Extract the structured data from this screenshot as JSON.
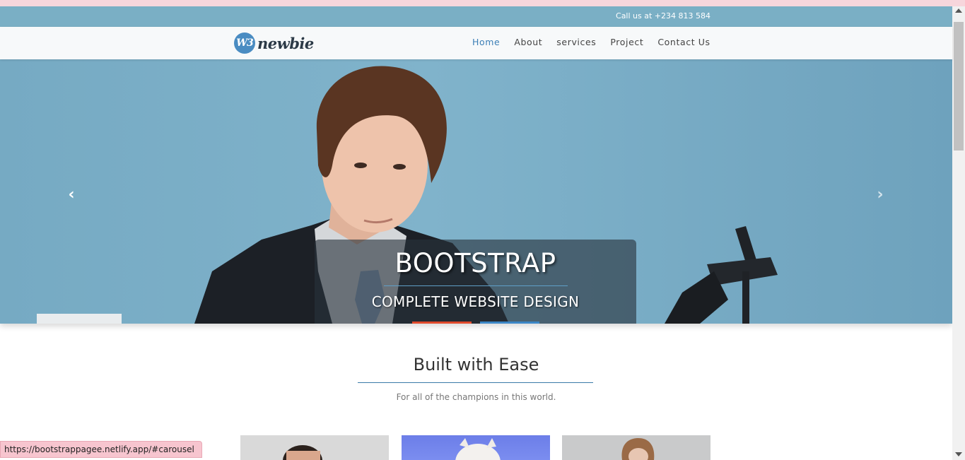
{
  "topbar": {
    "call_text": "Call us at +234 813 584"
  },
  "navbar": {
    "logo_badge": "W3",
    "logo_word": "newbie",
    "items": [
      {
        "label": "Home",
        "active": true
      },
      {
        "label": "About",
        "active": false
      },
      {
        "label": "services",
        "active": false
      },
      {
        "label": "Project",
        "active": false
      },
      {
        "label": "Contact Us",
        "active": false
      }
    ]
  },
  "carousel": {
    "prev_glyph": "‹",
    "next_glyph": "›",
    "caption_title": "BOOTSTRAP",
    "caption_subtitle": "COMPLETE WEBSITE DESIGN",
    "active_indicator": 1,
    "indicator_colors": [
      "#e04a2c",
      "#3b86c6"
    ]
  },
  "section": {
    "title": "Built with Ease",
    "subtitle": "For all of the champions in this world."
  },
  "status_bar": {
    "url": "https://bootstrappagee.netlify.app/#carousel"
  },
  "colors": {
    "accent": "#3c7fb6",
    "topbar": "#7aafc5",
    "hero_bg": "#7aaec6"
  }
}
